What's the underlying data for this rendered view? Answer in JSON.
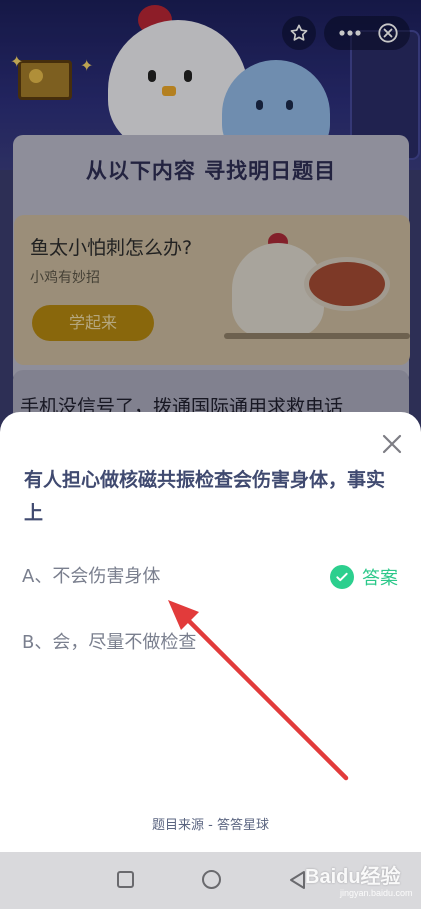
{
  "background": {
    "find_title": "从以下内容  寻找明日题目",
    "card1": {
      "title": "鱼太小怕刺怎么办?",
      "subtitle": "小鸡有妙招",
      "button_label": "学起来"
    },
    "card2": {
      "title": "手机没信号了，拨通国际通用求救电话"
    }
  },
  "top_actions": {
    "favorite_icon": "star-icon",
    "more_icon": "more-icon",
    "close_icon": "close-circle-icon"
  },
  "sheet": {
    "question": "有人担心做核磁共振检查会伤害身体，事实上",
    "options": [
      {
        "label": "A、不会伤害身体",
        "is_answer": true
      },
      {
        "label": "B、会，尽量不做检查",
        "is_answer": false
      }
    ],
    "answer_label": "答案",
    "source": "题目来源 - 答答星球",
    "colors": {
      "question": "#404a70",
      "option": "#7a7f8e",
      "answer": "#2cc88a",
      "arrow": "#e23b3b"
    }
  },
  "navbar": {
    "watermark": "Baidu经验",
    "watermark_sub": "jingyan.baidu.com"
  }
}
